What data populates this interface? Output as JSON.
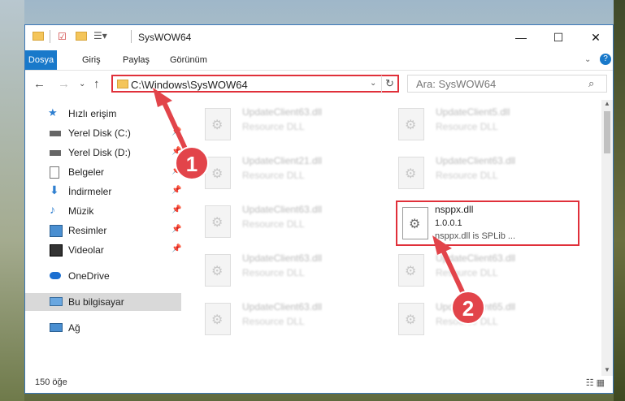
{
  "window": {
    "title": "SysWOW64",
    "controls": {
      "minimize": "—",
      "maximize": "☐",
      "close": "✕"
    }
  },
  "ribbon": {
    "tabs": [
      "Dosya",
      "Giriş",
      "Paylaş",
      "Görünüm"
    ],
    "help_icon": "help-icon"
  },
  "address": {
    "path": "C:\\Windows\\SysWOW64",
    "search_placeholder": "Ara: SysWOW64"
  },
  "nav": {
    "items": [
      {
        "label": "Hızlı erişim",
        "icon": "star-icon",
        "pinned": false
      },
      {
        "label": "Yerel Disk (C:)",
        "icon": "drive-icon",
        "pinned": true
      },
      {
        "label": "Yerel Disk (D:)",
        "icon": "drive-icon",
        "pinned": true
      },
      {
        "label": "Belgeler",
        "icon": "document-icon",
        "pinned": true
      },
      {
        "label": "İndirmeler",
        "icon": "download-icon",
        "pinned": true
      },
      {
        "label": "Müzik",
        "icon": "music-icon",
        "pinned": true
      },
      {
        "label": "Resimler",
        "icon": "pictures-icon",
        "pinned": true
      },
      {
        "label": "Videolar",
        "icon": "video-icon",
        "pinned": true
      },
      {
        "label": "OneDrive",
        "icon": "cloud-icon",
        "pinned": false
      },
      {
        "label": "Bu bilgisayar",
        "icon": "computer-icon",
        "pinned": false,
        "selected": true
      },
      {
        "label": "Ağ",
        "icon": "network-icon",
        "pinned": false
      }
    ]
  },
  "files": {
    "tiles": [
      {
        "name": "UpdateClient63.dll",
        "desc": "Resource DLL"
      },
      {
        "name": "UpdateClient5.dll",
        "desc": "Resource DLL"
      },
      {
        "name": "UpdateClient21.dll",
        "desc": "Resource DLL"
      },
      {
        "name": "UpdateClient63.dll",
        "desc": "Resource DLL"
      },
      {
        "name": "UpdateClient63.dll",
        "desc": "Resource DLL"
      },
      {
        "name": "nsppx.dll",
        "version": "1.0.0.1",
        "desc": "nsppx.dll is SPLib ..."
      },
      {
        "name": "UpdateClient63.dll",
        "desc": "Resource DLL"
      },
      {
        "name": "UpdateClient63.dll",
        "desc": "Resource DLL"
      },
      {
        "name": "UpdateClient63.dll",
        "desc": "Resource DLL"
      },
      {
        "name": "UpdateClient65.dll",
        "desc": "Resource DLL"
      }
    ]
  },
  "status": {
    "count": "150 öğe"
  },
  "markers": {
    "one": "1",
    "two": "2"
  },
  "colors": {
    "accent": "#1979ca",
    "highlight": "#e0303a"
  }
}
